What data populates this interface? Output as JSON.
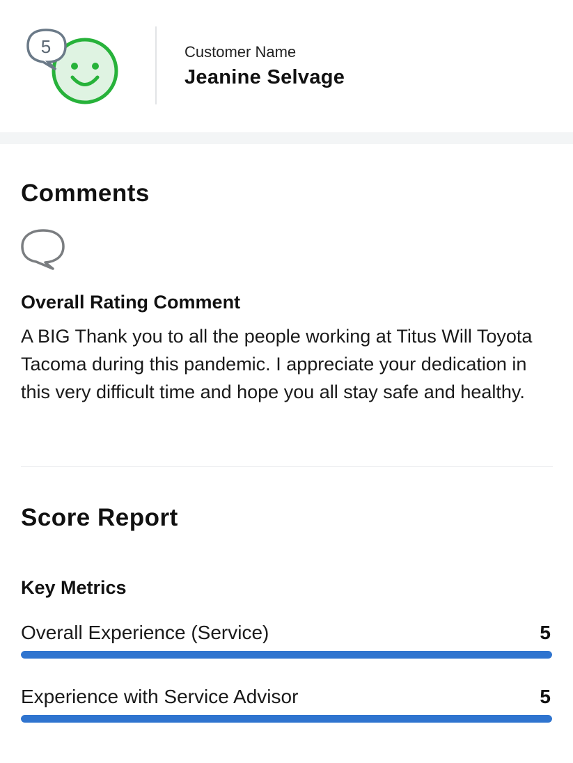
{
  "header": {
    "rating_badge": "5",
    "rating_face_icon": "smiley-face-icon",
    "rating_color": "#27b23a",
    "customer_label": "Customer Name",
    "customer_name": "Jeanine Selvage"
  },
  "comments": {
    "title": "Comments",
    "icon": "speech-bubble-icon",
    "label": "Overall Rating Comment",
    "text": "A BIG Thank you to all the people working at Titus Will Toyota Tacoma during this pandemic. I appreciate your dedication in this very difficult time and hope you all stay safe and healthy."
  },
  "score_report": {
    "title": "Score Report",
    "key_metrics_label": "Key Metrics",
    "bar_color": "#2f74cf",
    "metrics": [
      {
        "name": "Overall Experience (Service)",
        "score": "5",
        "fill_fraction": 1.0
      },
      {
        "name": "Experience with Service Advisor",
        "score": "5",
        "fill_fraction": 1.0
      }
    ]
  }
}
